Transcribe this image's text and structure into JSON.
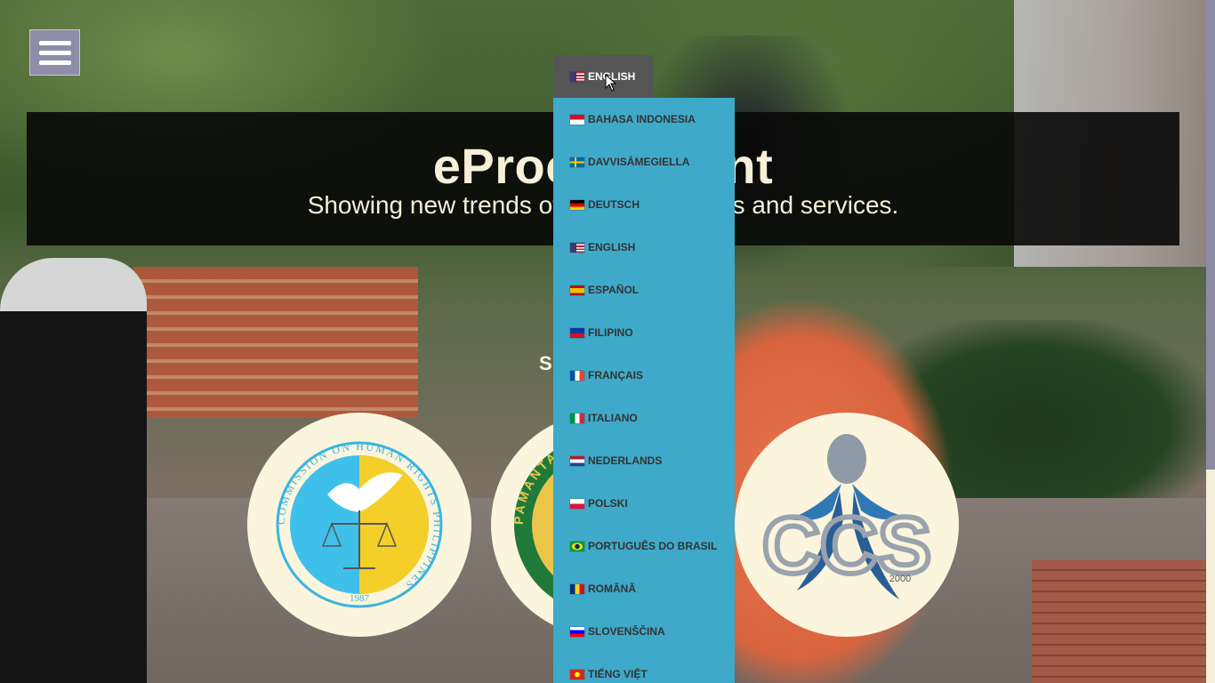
{
  "header": {
    "title": "eProcurement",
    "subtitle": "Showing new trends of procuring goods and services."
  },
  "sponsor_text": "Sponsored by:",
  "logos": [
    {
      "name": "Commission on Human Rights Philippines",
      "ring_text": "COMMISSION ON HUMAN RIGHTS PHILIPPINES",
      "year": "1987"
    },
    {
      "name": "Pamantasan",
      "ring_text": "PAMANTASAN"
    },
    {
      "name": "CCS",
      "badge": "CCS",
      "year": "2000"
    }
  ],
  "language_selector": {
    "current": {
      "label": "English",
      "flag": "us"
    },
    "options": [
      {
        "label": "Bahasa Indonesia",
        "flag": "id"
      },
      {
        "label": "Davvisámegiella",
        "flag": "se"
      },
      {
        "label": "Deutsch",
        "flag": "de"
      },
      {
        "label": "English",
        "flag": "us"
      },
      {
        "label": "Español",
        "flag": "es"
      },
      {
        "label": "Filipino",
        "flag": "ph"
      },
      {
        "label": "Français",
        "flag": "fr"
      },
      {
        "label": "Italiano",
        "flag": "it"
      },
      {
        "label": "Nederlands",
        "flag": "nl"
      },
      {
        "label": "Polski",
        "flag": "pl"
      },
      {
        "label": "Português do Brasil",
        "flag": "br"
      },
      {
        "label": "Română",
        "flag": "ro"
      },
      {
        "label": "Slovenščina",
        "flag": "si"
      },
      {
        "label": "Tiếng Việt",
        "flag": "vn"
      }
    ]
  },
  "icons": {
    "menu": "hamburger-icon",
    "cursor": "mouse-pointer-icon"
  },
  "colors": {
    "dropdown": "#3fa9c9",
    "trigger": "#555555",
    "banner": "#080808",
    "menu_button": "#8f8ea8"
  }
}
